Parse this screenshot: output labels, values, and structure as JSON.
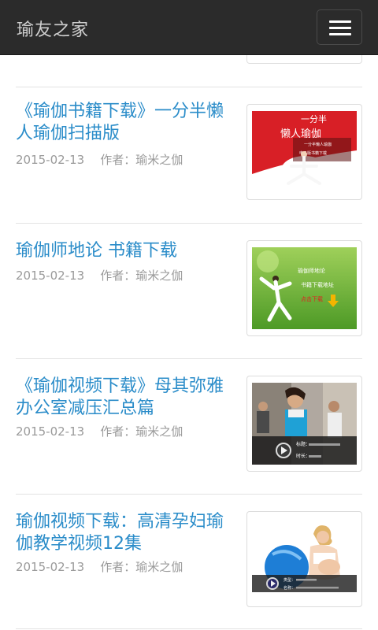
{
  "header": {
    "brand": "瑜友之家",
    "menu_icon": "hamburger-menu-icon"
  },
  "posts": [
    {
      "title": "《瑜伽书籍下载》一分半懒人瑜伽扫描版",
      "date": "2015-02-13",
      "author": "作者：瑜米之伽",
      "thumb_text": [
        "一分半",
        "懒人瑜伽",
        "一分半懒人瑜伽",
        "电子版书籍下载"
      ]
    },
    {
      "title": "瑜伽师地论 书籍下载",
      "date": "2015-02-13",
      "author": "作者：瑜米之伽",
      "thumb_text": [
        "瑜伽师地论",
        "书籍下载地址",
        "点击下载"
      ]
    },
    {
      "title": "《瑜伽视频下载》母其弥雅办公室减压汇总篇",
      "date": "2015-02-13",
      "author": "作者：瑜米之伽",
      "thumb_text": [
        "标题：",
        "时长："
      ]
    },
    {
      "title": "瑜伽视频下载：高清孕妇瑜伽教学视频12集",
      "date": "2015-02-13",
      "author": "作者：瑜米之伽",
      "thumb_text": [
        "类型：",
        "名称："
      ]
    }
  ],
  "colors": {
    "header_bg": "#2b2b2b",
    "title": "#2a8cc9",
    "meta": "#9a9a9a"
  }
}
